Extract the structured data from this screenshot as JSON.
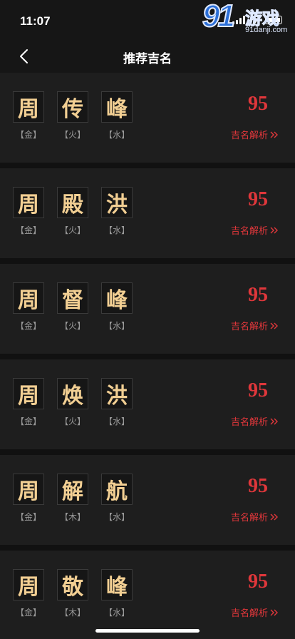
{
  "status_bar": {
    "time": "11:07"
  },
  "watermark": {
    "logo_number": "91",
    "logo_text": "游戏",
    "domain": "91danji.com"
  },
  "nav": {
    "title": "推荐吉名",
    "back_icon": "chevron-left-icon"
  },
  "analysis_label": "吉名解析",
  "colors": {
    "accent": "#e0373b",
    "gold": "#f2cf93",
    "card": "#1e1e1e",
    "background": "#111111"
  },
  "names": [
    {
      "chars": [
        {
          "char": "周",
          "element": "【金】"
        },
        {
          "char": "传",
          "element": "【火】"
        },
        {
          "char": "峰",
          "element": "【水】"
        }
      ],
      "score": "95"
    },
    {
      "chars": [
        {
          "char": "周",
          "element": "【金】"
        },
        {
          "char": "殿",
          "element": "【火】"
        },
        {
          "char": "洪",
          "element": "【水】"
        }
      ],
      "score": "95"
    },
    {
      "chars": [
        {
          "char": "周",
          "element": "【金】"
        },
        {
          "char": "督",
          "element": "【火】"
        },
        {
          "char": "峰",
          "element": "【水】"
        }
      ],
      "score": "95"
    },
    {
      "chars": [
        {
          "char": "周",
          "element": "【金】"
        },
        {
          "char": "焕",
          "element": "【火】"
        },
        {
          "char": "洪",
          "element": "【水】"
        }
      ],
      "score": "95"
    },
    {
      "chars": [
        {
          "char": "周",
          "element": "【金】"
        },
        {
          "char": "解",
          "element": "【木】"
        },
        {
          "char": "航",
          "element": "【水】"
        }
      ],
      "score": "95"
    },
    {
      "chars": [
        {
          "char": "周",
          "element": "【金】"
        },
        {
          "char": "敬",
          "element": "【木】"
        },
        {
          "char": "峰",
          "element": "【水】"
        }
      ],
      "score": "95"
    }
  ]
}
